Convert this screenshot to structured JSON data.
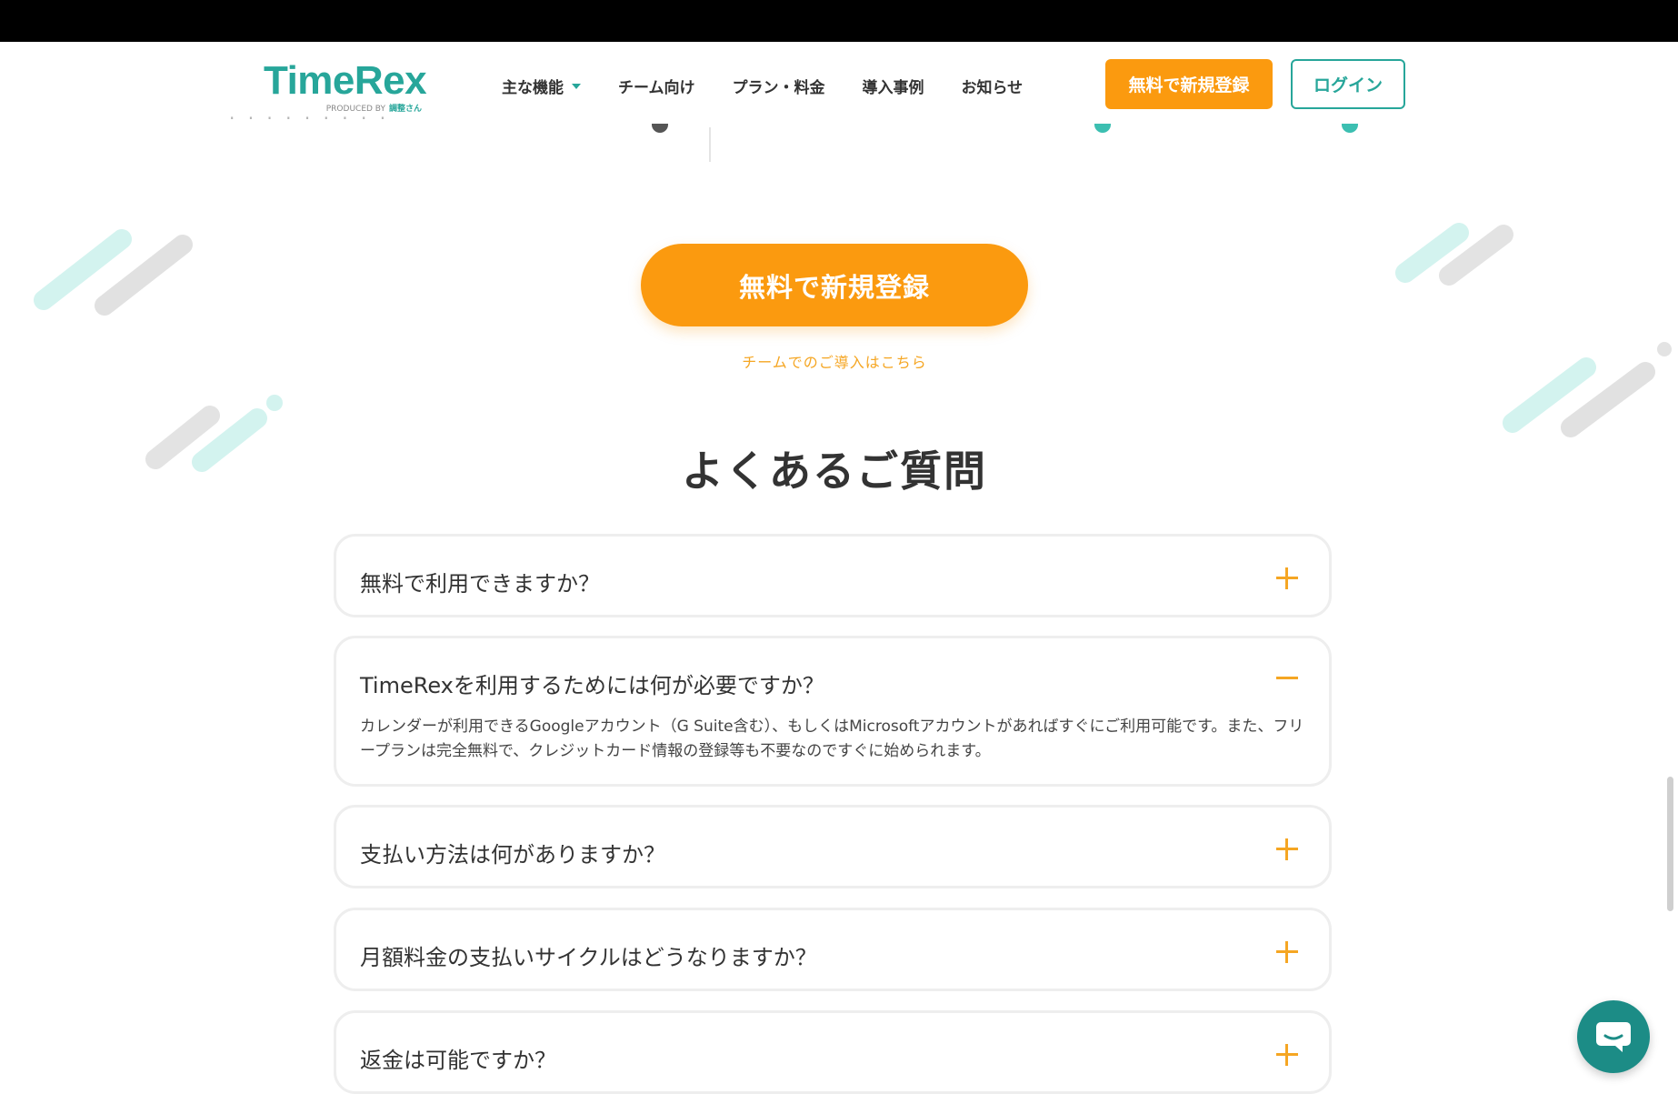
{
  "header": {
    "logo": {
      "name": "TimeRex",
      "produced_by": "PRODUCED BY",
      "brand": "調整さん"
    },
    "nav": [
      {
        "label": "主な機能",
        "has_dropdown": true
      },
      {
        "label": "チーム向け"
      },
      {
        "label": "プラン・料金"
      },
      {
        "label": "導入事例"
      },
      {
        "label": "お知らせ"
      }
    ],
    "signup_label": "無料で新規登録",
    "login_label": "ログイン"
  },
  "cta": {
    "signup_label": "無料で新規登録",
    "team_link": "チームでのご導入はこちら"
  },
  "faq": {
    "title": "よくあるご質問",
    "items": [
      {
        "question": "無料で利用できますか？",
        "expanded": false
      },
      {
        "question": "TimeRexを利用するためには何が必要ですか？",
        "expanded": true,
        "answer": "カレンダーが利用できるGoogleアカウント（G Suite含む）、もしくはMicrosoftアカウントがあればすぐにご利用可能です。また、フリープランは完全無料で、クレジットカード情報の登録等も不要なのですぐに始められます。"
      },
      {
        "question": "支払い方法は何がありますか？",
        "expanded": false
      },
      {
        "question": "月額料金の支払いサイクルはどうなりますか？",
        "expanded": false
      },
      {
        "question": "返金は可能ですか？",
        "expanded": false
      }
    ]
  },
  "icons": {
    "expand": "plus-icon",
    "collapse": "minus-icon",
    "chat": "chat-bubble-icon",
    "dropdown": "caret-down-icon"
  },
  "colors": {
    "brand_teal": "#27a69a",
    "accent_orange": "#fb9a0f",
    "chat_teal": "#1c8c86"
  }
}
